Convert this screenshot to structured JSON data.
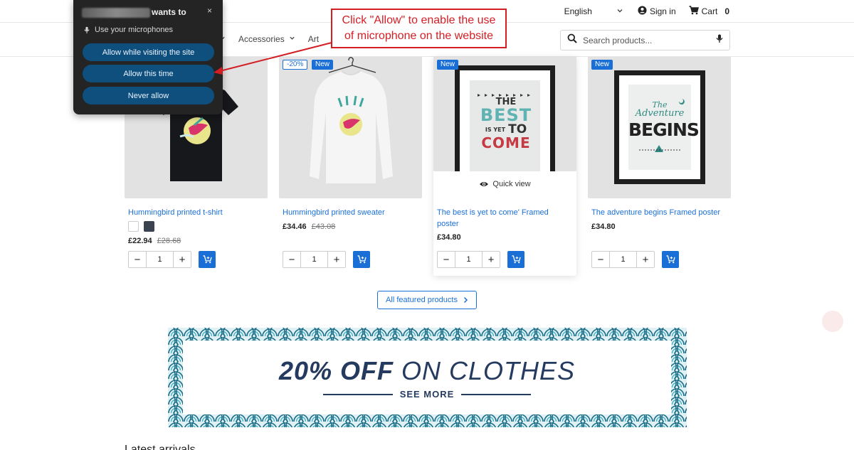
{
  "header": {
    "language": "English",
    "signin_label": "Sign in",
    "cart_label": "Cart",
    "cart_count": "0"
  },
  "nav": {
    "items": [
      {
        "label": "Accessories",
        "has_dropdown": true
      },
      {
        "label": "Art",
        "has_dropdown": false
      }
    ]
  },
  "search": {
    "placeholder": "Search products...",
    "value": ""
  },
  "permission_popup": {
    "title_suffix": "wants to",
    "permission_text": "Use your microphones",
    "buttons": [
      "Allow while visiting the site",
      "Allow this time",
      "Never allow"
    ],
    "close_label": "×"
  },
  "annotation": {
    "text_line1": "Click \"Allow\" to enable the use",
    "text_line2": "of microphone on the website",
    "color": "#d31e24"
  },
  "products": [
    {
      "name": "Hummingbird printed t-shirt",
      "price": "£22.94",
      "old_price": "£28.68",
      "badges": [],
      "swatches": [
        "#ffffff",
        "#3b4250"
      ],
      "quantity": "1"
    },
    {
      "name": "Hummingbird printed sweater",
      "price": "£34.46",
      "old_price": "£43.08",
      "badges": [
        "-20%",
        "New"
      ],
      "quantity": "1"
    },
    {
      "name": "The best is yet to come' Framed poster",
      "price": "£34.80",
      "badges": [
        "New"
      ],
      "quick_view": "Quick view",
      "poster_text": [
        "THE",
        "BEST",
        "IS YET",
        "TO",
        "COME"
      ],
      "quantity": "1"
    },
    {
      "name": "The adventure begins Framed poster",
      "price": "£34.80",
      "badges": [
        "New"
      ],
      "poster_text": [
        "The",
        "Adventure",
        "BEGINS"
      ],
      "quantity": "1"
    }
  ],
  "all_products_button": "All featured products",
  "banner": {
    "bold": "20% OFF",
    "rest": "ON CLOTHES",
    "sub": "SEE MORE",
    "color": "#243a5e"
  },
  "section_heading": "Latest arrivals",
  "colors": {
    "accent": "#1a6fd6",
    "popup_bg": "#242424",
    "popup_button": "#0f4f7d"
  }
}
